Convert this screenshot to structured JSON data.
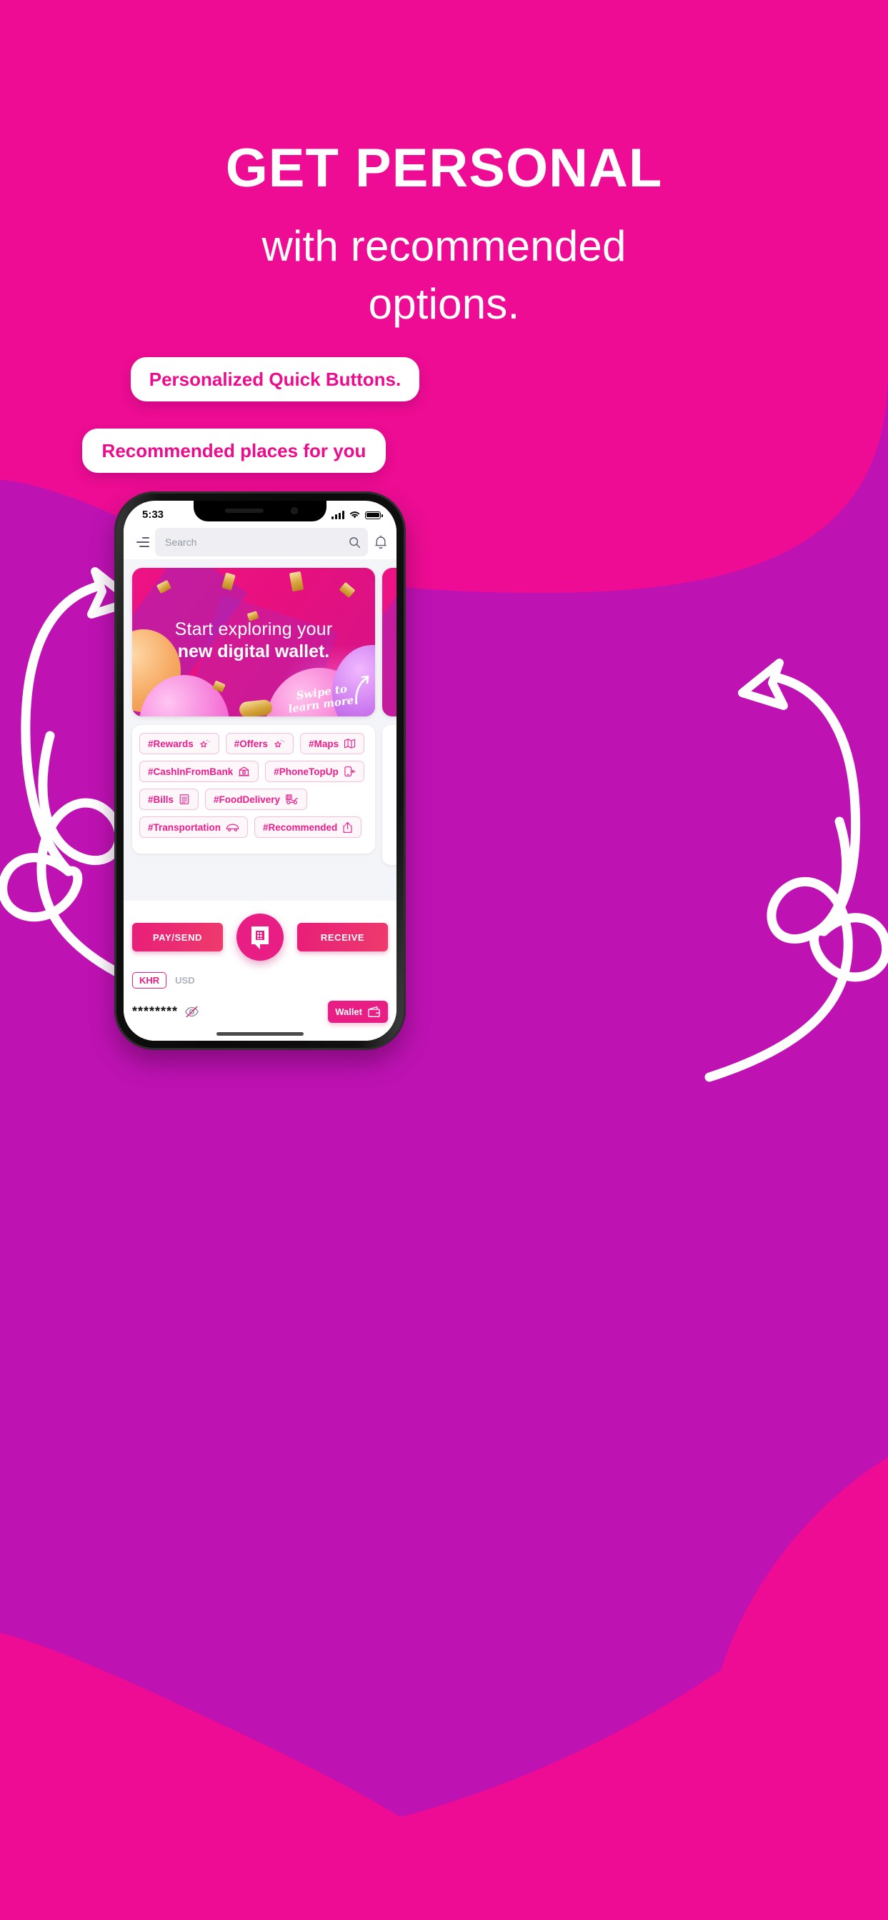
{
  "colors": {
    "bg_pink": "#ED0C93",
    "bg_purple": "#BE12B3",
    "accent_pink": "#E81E85",
    "chip_pink": "#EC1C8C",
    "white": "#FFFFFF"
  },
  "header": {
    "title": "GET PERSONAL",
    "subtitle_line1": "with recommended",
    "subtitle_line2": "options."
  },
  "callouts": [
    {
      "id": "quick-buttons",
      "label": "Personalized Quick Buttons."
    },
    {
      "id": "recommended-places",
      "label": "Recommended places for you"
    }
  ],
  "phone": {
    "statusbar": {
      "time": "5:33",
      "signal_icon": "cellular-bars-icon",
      "wifi_icon": "wifi-icon",
      "battery_icon": "battery-full-icon"
    },
    "topbar": {
      "menu_icon": "hamburger-menu-icon",
      "search_placeholder": "Search",
      "search_value": "",
      "search_icon": "search-icon",
      "notification_icon": "bell-icon"
    },
    "banner": {
      "line1": "Start exploring your",
      "line2": "new digital wallet.",
      "swipe_line1": "Swipe to",
      "swipe_line2": "learn more!"
    },
    "chips": [
      [
        {
          "label": "#Rewards",
          "icon": "star-sparkle-icon"
        },
        {
          "label": "#Offers",
          "icon": "star-sparkle-icon"
        },
        {
          "label": "#Maps",
          "icon": "map-icon"
        }
      ],
      [
        {
          "label": "#CashInFromBank",
          "icon": "bank-icon"
        },
        {
          "label": "#PhoneTopUp",
          "icon": "phone-topup-icon"
        }
      ],
      [
        {
          "label": "#Bills",
          "icon": "bill-document-icon"
        },
        {
          "label": "#FoodDelivery",
          "icon": "delivery-scooter-icon"
        }
      ],
      [
        {
          "label": "#Transportation",
          "icon": "car-icon"
        },
        {
          "label": "#Recommended",
          "icon": "share-upload-icon"
        }
      ]
    ],
    "actions": {
      "pay_send_label": "PAY/SEND",
      "receive_label": "RECEIVE",
      "qr_icon": "pi-pay-qr-logo-icon"
    },
    "wallet": {
      "currency_selected": "KHR",
      "currency_other": "USD",
      "balance_masked": "********",
      "eye_icon": "eye-off-icon",
      "wallet_label": "Wallet",
      "wallet_icon": "wallet-icon"
    }
  }
}
